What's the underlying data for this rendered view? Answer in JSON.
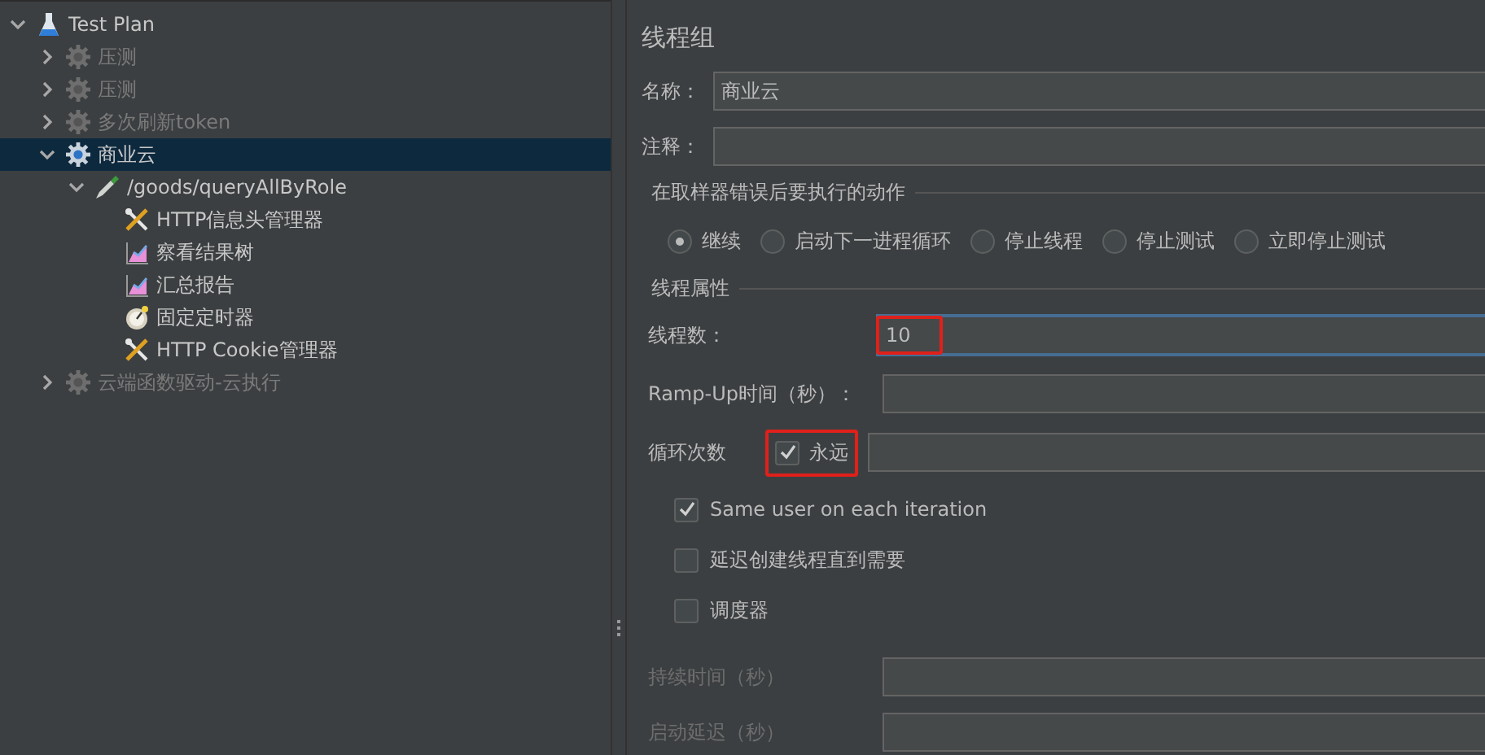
{
  "tree": [
    {
      "label": "Test Plan",
      "kind": "plan",
      "disabled": false,
      "selected": false,
      "expanded": true,
      "children": [
        {
          "label": "压测",
          "kind": "thread-group",
          "disabled": true,
          "selected": false,
          "expanded": false
        },
        {
          "label": "压测",
          "kind": "thread-group",
          "disabled": true,
          "selected": false,
          "expanded": false
        },
        {
          "label": "多次刷新token",
          "kind": "thread-group",
          "disabled": true,
          "selected": false,
          "expanded": false
        },
        {
          "label": "商业云",
          "kind": "thread-group",
          "disabled": false,
          "selected": true,
          "expanded": true,
          "children": [
            {
              "label": "/goods/queryAllByRole",
              "kind": "sampler",
              "disabled": false,
              "selected": false,
              "expanded": true,
              "children": [
                {
                  "label": "HTTP信息头管理器",
                  "kind": "config",
                  "disabled": false,
                  "selected": false
                },
                {
                  "label": "察看结果树",
                  "kind": "listener",
                  "disabled": false,
                  "selected": false
                },
                {
                  "label": "汇总报告",
                  "kind": "listener",
                  "disabled": false,
                  "selected": false
                },
                {
                  "label": "固定定时器",
                  "kind": "timer",
                  "disabled": false,
                  "selected": false
                },
                {
                  "label": "HTTP Cookie管理器",
                  "kind": "config",
                  "disabled": false,
                  "selected": false
                }
              ]
            }
          ]
        },
        {
          "label": "云端函数驱动-云执行",
          "kind": "thread-group",
          "disabled": true,
          "selected": false,
          "expanded": false
        }
      ]
    }
  ],
  "panel": {
    "title": "线程组",
    "name": {
      "label": "名称：",
      "value": "商业云"
    },
    "comment": {
      "label": "注释："
    },
    "error_action": {
      "title": "在取样器错误后要执行的动作",
      "options": [
        {
          "label": "继续",
          "selected": true
        },
        {
          "label": "启动下一进程循环",
          "selected": false
        },
        {
          "label": "停止线程",
          "selected": false
        },
        {
          "label": "停止测试",
          "selected": false
        },
        {
          "label": "立即停止测试",
          "selected": false
        }
      ]
    },
    "thread_properties": {
      "title": "线程属性",
      "thread_count": {
        "label": "线程数：",
        "value": "10",
        "annotated": true
      },
      "ramp_up": {
        "label": "Ramp-Up时间（秒）："
      },
      "loop_count": {
        "label": "循环次数",
        "forever": {
          "label": "永远",
          "checked": true,
          "annotated": true
        }
      },
      "checkboxes": [
        {
          "label": "Same user on each iteration",
          "checked": true
        },
        {
          "label": "延迟创建线程直到需要",
          "checked": false
        },
        {
          "label": "调度器",
          "checked": false
        }
      ],
      "duration": {
        "label": "持续时间（秒）",
        "disabled": true
      },
      "startup_delay": {
        "label": "启动延迟（秒）",
        "disabled": true
      }
    }
  }
}
